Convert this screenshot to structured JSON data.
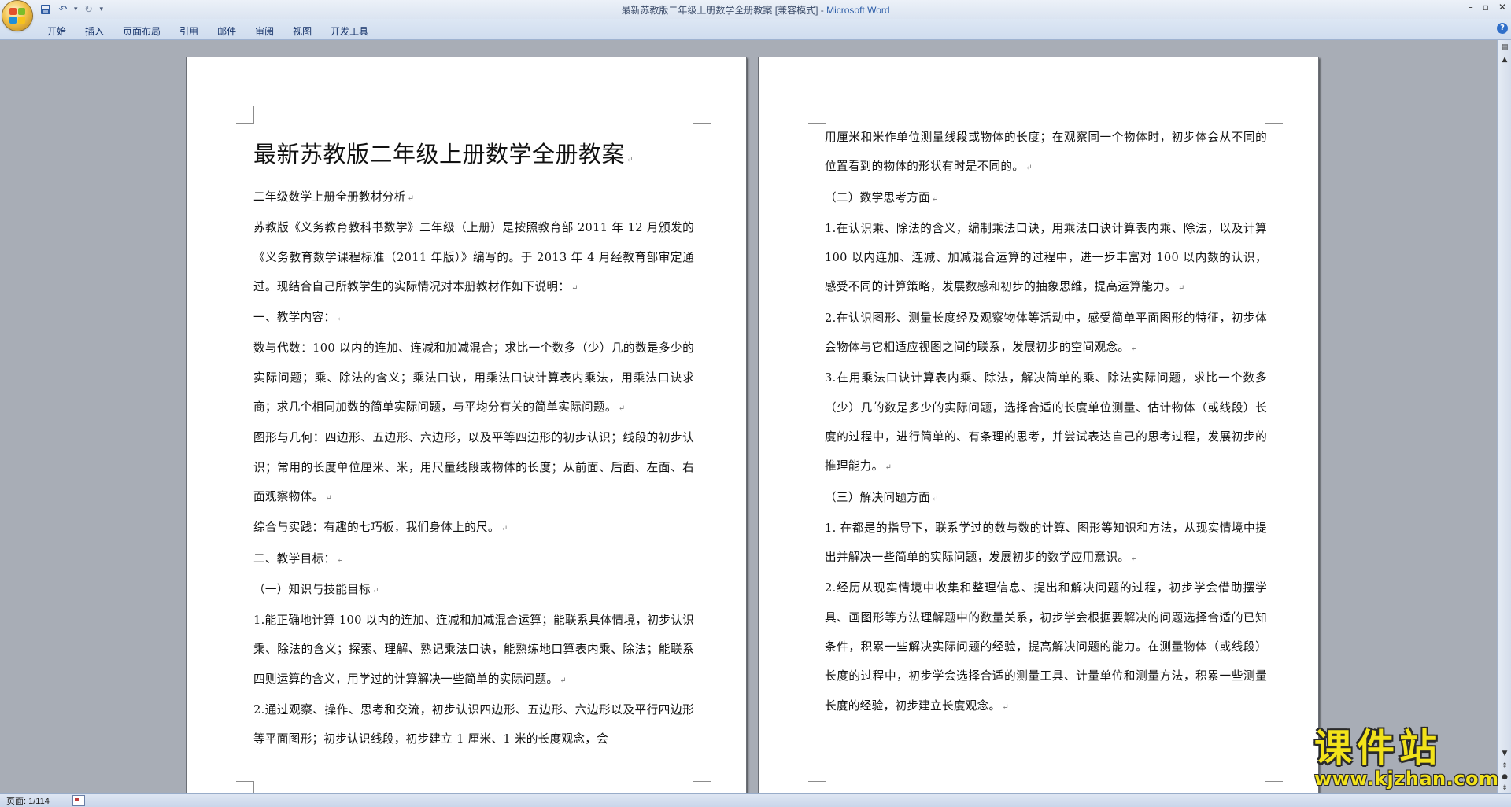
{
  "window": {
    "title_doc": "最新苏教版二年级上册数学全册教案 [兼容模式] - ",
    "title_app": "Microsoft Word"
  },
  "ribbon": {
    "tabs": [
      "开始",
      "插入",
      "页面布局",
      "引用",
      "邮件",
      "审阅",
      "视图",
      "开发工具"
    ]
  },
  "left_page": {
    "title": "最新苏教版二年级上册数学全册教案",
    "paragraphs": [
      "二年级数学上册全册教材分析",
      "苏教版《义务教育教科书数学》二年级（上册）是按照教育部 2011 年 12 月颁发的《义务教育数学课程标准（2011 年版）》编写的。于 2013 年 4 月经教育部审定通过。现结合自己所教学生的实际情况对本册教材作如下说明：",
      "一、教学内容：",
      "数与代数：100 以内的连加、连减和加减混合；求比一个数多（少）几的数是多少的实际问题；乘、除法的含义；乘法口诀，用乘法口诀计算表内乘法，用乘法口诀求商；求几个相同加数的简单实际问题，与平均分有关的简单实际问题。",
      "图形与几何：四边形、五边形、六边形，以及平等四边形的初步认识；线段的初步认识；常用的长度单位厘米、米，用尺量线段或物体的长度；从前面、后面、左面、右面观察物体。",
      "综合与实践：有趣的七巧板，我们身体上的尺。",
      "二、教学目标：",
      "（一）知识与技能目标",
      "1.能正确地计算 100 以内的连加、连减和加减混合运算；能联系具体情境，初步认识乘、除法的含义；探索、理解、熟记乘法口诀，能熟练地口算表内乘、除法；能联系四则运算的含义，用学过的计算解决一些简单的实际问题。",
      "2.通过观察、操作、思考和交流，初步认识四边形、五边形、六边形以及平行四边形等平面图形；初步认识线段，初步建立 1 厘米、1 米的长度观念，会"
    ]
  },
  "right_page": {
    "paragraphs": [
      "用厘米和米作单位测量线段或物体的长度；在观察同一个物体时，初步体会从不同的位置看到的物体的形状有时是不同的。",
      "（二）数学思考方面",
      "1.在认识乘、除法的含义，编制乘法口诀，用乘法口诀计算表内乘、除法，以及计算 100 以内连加、连减、加减混合运算的过程中，进一步丰富对 100 以内数的认识，感受不同的计算策略，发展数感和初步的抽象思维，提高运算能力。",
      "2.在认识图形、测量长度经及观察物体等活动中，感受简单平面图形的特征，初步体会物体与它相适应视图之间的联系，发展初步的空间观念。",
      "3.在用乘法口诀计算表内乘、除法，解决简单的乘、除法实际问题，求比一个数多（少）几的数是多少的实际问题，选择合适的长度单位测量、估计物体（或线段）长度的过程中，进行简单的、有条理的思考，并尝试表达自己的思考过程，发展初步的推理能力。",
      "（三）解决问题方面",
      "1.  在都是的指导下，联系学过的数与数的计算、图形等知识和方法，从现实情境中提出并解决一些简单的实际问题，发展初步的数学应用意识。",
      "2.经历从现实情境中收集和整理信息、提出和解决问题的过程，初步学会借助摆学具、画图形等方法理解题中的数量关系，初步学会根据要解决的问题选择合适的已知条件，积累一些解决实际问题的经验，提高解决问题的能力。在测量物体（或线段）长度的过程中，初步学会选择合适的测量工具、计量单位和测量方法，积累一些测量长度的经验，初步建立长度观念。"
    ]
  },
  "status": {
    "page_info": "页面: 1/114"
  },
  "watermark": {
    "main": "课件站",
    "url": "www.kjzhan.com"
  },
  "icons": {
    "save": "save-icon",
    "undo": "undo-icon",
    "redo": "redo-icon",
    "help": "help-icon"
  }
}
